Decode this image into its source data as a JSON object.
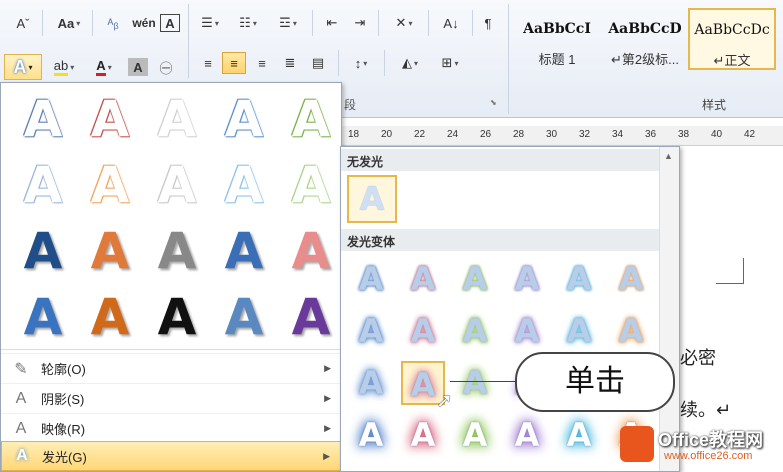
{
  "ribbon": {
    "font_shrink": "Aˇ",
    "change_case": "Aa",
    "phonetic": "wén",
    "char_border": "A",
    "sort": "A↓",
    "styles": [
      {
        "preview": "AaBbCcI",
        "name": "标题 1"
      },
      {
        "preview": "AaBbCcD",
        "name": "↵第2级标..."
      },
      {
        "preview": "AaBbCcDc",
        "name": "↵正文"
      }
    ],
    "paragraph_group_label": "段",
    "styles_group_label": "样式"
  },
  "ruler": {
    "ticks": [
      "18",
      "20",
      "22",
      "24",
      "26",
      "28",
      "30",
      "32",
      "34",
      "36",
      "38",
      "40",
      "42"
    ]
  },
  "effects_menu": {
    "gallery_letter": "A",
    "gallery_rows": [
      [
        "#5b7fb0",
        "#c0504d",
        "#d0d0d0",
        "#5b8fd0",
        "#7cb04a"
      ],
      [
        "#9ab6dd",
        "#f2a25a",
        "#c8c8c8",
        "#8ec0ea",
        "#a8d48a"
      ],
      [
        "#1f4e89",
        "#e07a3a",
        "#888888",
        "#3a6fb8",
        "#e88c8c"
      ],
      [
        "#3a74c0",
        "#d06a1a",
        "#111111",
        "#5a88c0",
        "#6a3a9a"
      ]
    ],
    "items": [
      {
        "label": "轮廓(O)",
        "icon": "outline-icon"
      },
      {
        "label": "阴影(S)",
        "icon": "shadow-icon"
      },
      {
        "label": "映像(R)",
        "icon": "reflection-icon"
      },
      {
        "label": "发光(G)",
        "icon": "glow-icon",
        "active": true
      }
    ]
  },
  "glow_menu": {
    "no_glow_label": "无发光",
    "variants_label": "发光变体",
    "letter": "A",
    "rows": [
      [
        "#6f9ad6",
        "#d88aa0",
        "#a6d07a",
        "#b59ad8",
        "#6fc4e4",
        "#f2b072"
      ],
      [
        "#6f9ad6",
        "#d88aa0",
        "#a6d07a",
        "#b59ad8",
        "#6fc4e4",
        "#f2b072"
      ],
      [
        "#6f9ad6",
        "#d88aa0",
        "#a6d07a",
        "#b59ad8",
        "#6fc4e4",
        "#f2b072"
      ],
      [
        "#4a7cc8",
        "#d85a78",
        "#86c04a",
        "#9a72d0",
        "#3ab4dc",
        "#ee9040"
      ]
    ]
  },
  "document": {
    "text_line1": "必密",
    "text_line2": "续。↵"
  },
  "callout": {
    "text": "单击"
  },
  "watermark": {
    "title": "Office教程网",
    "url": "www.office26.com"
  }
}
